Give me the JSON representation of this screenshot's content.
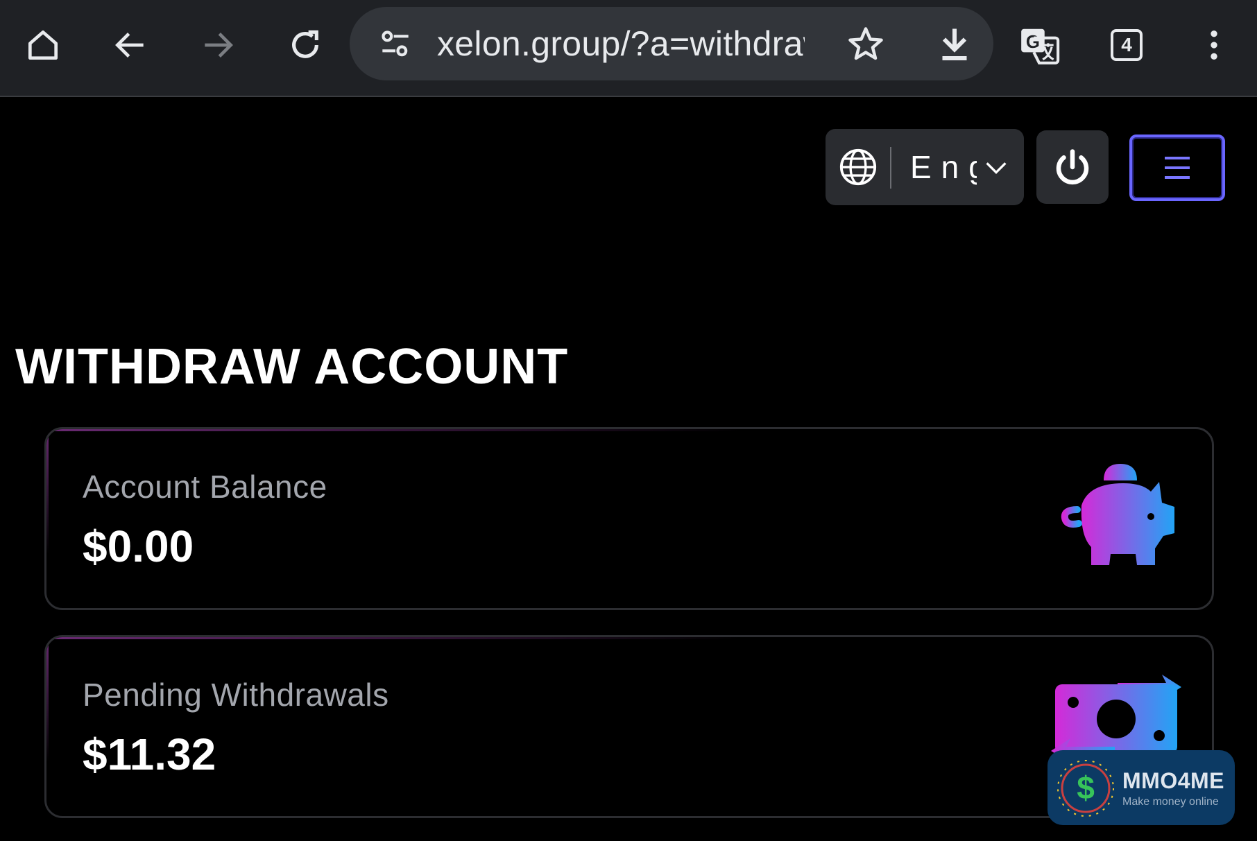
{
  "browser": {
    "url": "xelon.group/?a=withdraw",
    "tab_count": "4",
    "icons": [
      "home-icon",
      "back-icon",
      "forward-icon",
      "reload-icon",
      "site-settings-icon",
      "bookmark-star-icon",
      "download-icon",
      "translate-icon",
      "tab-switcher-icon",
      "more-menu-icon"
    ]
  },
  "header": {
    "language_label": "English",
    "icons": [
      "globe-icon",
      "chevron-down-icon",
      "power-icon",
      "hamburger-icon"
    ],
    "accent_color": "#6a66ff"
  },
  "page": {
    "title": "WITHDRAW ACCOUNT"
  },
  "cards": [
    {
      "label": "Account Balance",
      "value": "$0.00",
      "icon": "piggy-bank-icon"
    },
    {
      "label": "Pending Withdrawals",
      "value": "$11.32",
      "icon": "money-transfer-icon"
    }
  ],
  "watermark": {
    "title": "MMO4ME",
    "subtitle": "Make money online"
  },
  "colors": {
    "icon_gradient_start": "#d42ad8",
    "icon_gradient_end": "#22a4f5",
    "background": "#000000",
    "chrome_bg": "#1f2125"
  }
}
